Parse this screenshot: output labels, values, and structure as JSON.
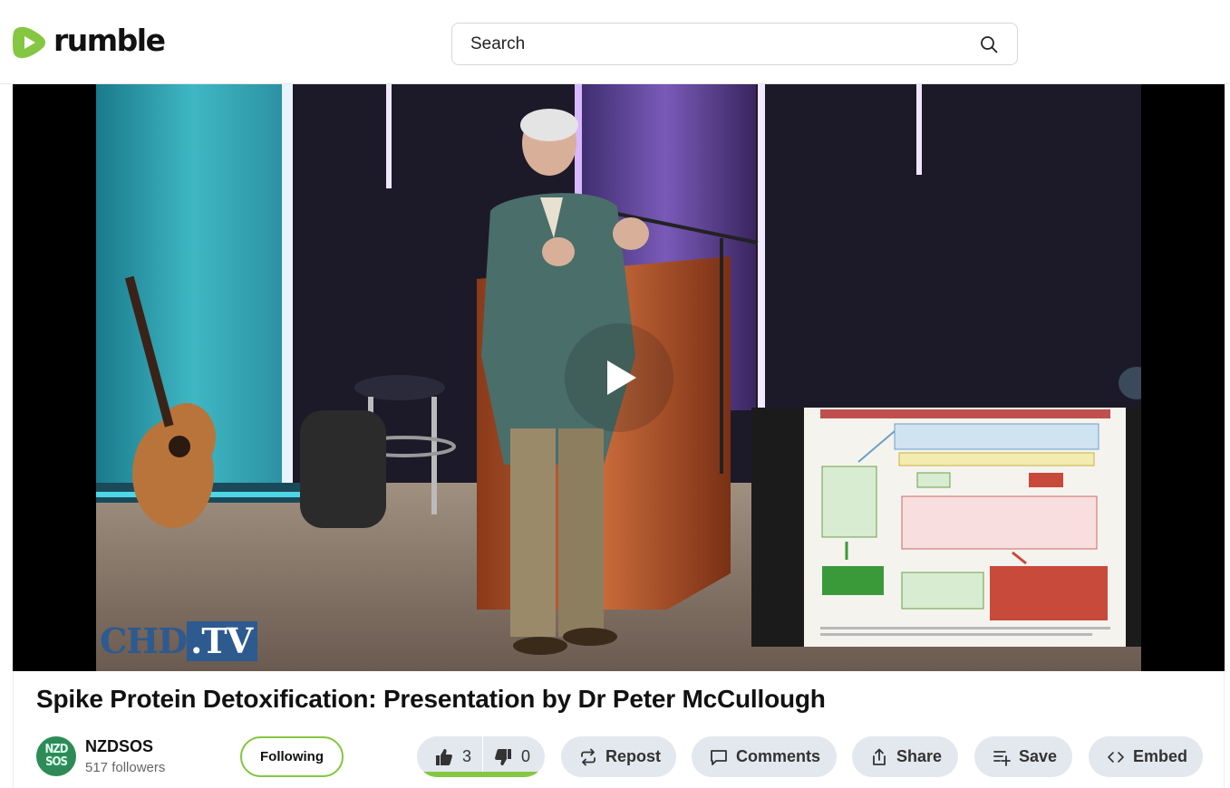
{
  "brand": {
    "name": "rumble",
    "accent": "#85c742"
  },
  "search": {
    "placeholder": "Search"
  },
  "player": {
    "watermark_left": "CHD",
    "watermark_right": ".TV"
  },
  "video": {
    "title": "Spike Protein Detoxification: Presentation by Dr Peter McCullough",
    "channel": {
      "avatar_line1": "NZD",
      "avatar_line2": "SOS",
      "name": "NZDSOS",
      "followers": "517 followers",
      "follow_label": "Following"
    },
    "votes": {
      "up": "3",
      "down": "0",
      "like_ratio": 1.0
    },
    "actions": {
      "repost": "Repost",
      "comments": "Comments",
      "share": "Share",
      "save": "Save",
      "embed": "Embed"
    }
  },
  "icons": {
    "logo": "rumble-play-logo",
    "search": "search-icon",
    "play": "play-icon",
    "thumbs_up": "thumbs-up-icon",
    "thumbs_down": "thumbs-down-icon",
    "repost": "repost-icon",
    "comments": "comment-icon",
    "share": "share-icon",
    "save": "playlist-add-icon",
    "embed": "embed-icon"
  }
}
